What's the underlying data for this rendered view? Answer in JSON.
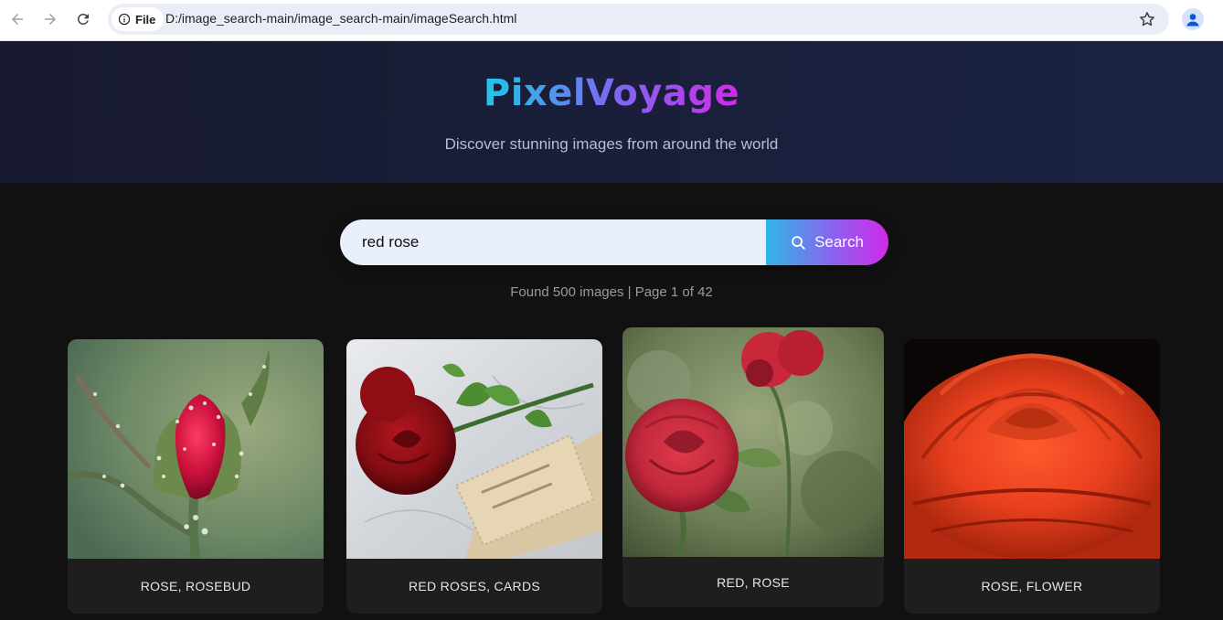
{
  "browser": {
    "back_icon": "arrow-left-icon",
    "forward_icon": "arrow-right-icon",
    "reload_icon": "reload-icon",
    "file_chip_label": "File",
    "url": "D:/image_search-main/image_search-main/imageSearch.html",
    "bookmark_icon": "star-icon",
    "profile_icon": "person-icon"
  },
  "hero": {
    "title": "PixelVoyage",
    "subtitle": "Discover stunning images from around the world"
  },
  "search": {
    "value": "red rose",
    "button_label": "Search",
    "button_icon": "search-icon"
  },
  "results": {
    "info": "Found 500 images | Page 1 of 42"
  },
  "cards": [
    {
      "caption": "ROSE, ROSEBUD"
    },
    {
      "caption": "RED ROSES, CARDS"
    },
    {
      "caption": "RED, ROSE"
    },
    {
      "caption": "ROSE, FLOWER"
    }
  ],
  "colors": {
    "background": "#111111",
    "hero_bg": "#1a1f3c",
    "accent_start": "#1fc7e8",
    "accent_end": "#d22ae8",
    "card_bg": "#1e1e1e"
  }
}
